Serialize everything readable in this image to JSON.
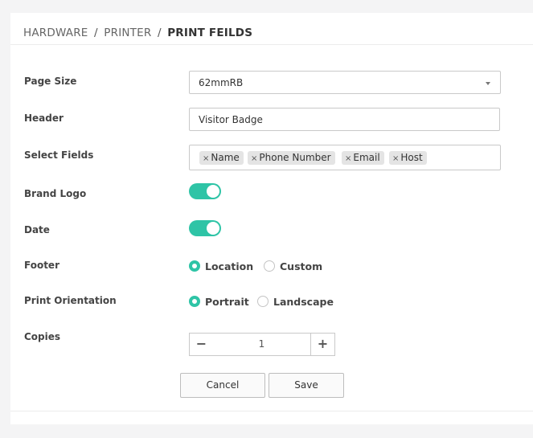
{
  "breadcrumb": {
    "items": [
      "HARDWARE",
      "PRINTER"
    ],
    "separator": "/",
    "current": "PRINT FEILDS"
  },
  "form": {
    "page_size": {
      "label": "Page Size",
      "value": "62mmRB"
    },
    "header": {
      "label": "Header",
      "value": "Visitor Badge"
    },
    "select_fields": {
      "label": "Select Fields",
      "remove_glyph": "×",
      "chips": [
        "Name",
        "Phone Number",
        "Email",
        "Host"
      ]
    },
    "brand_logo": {
      "label": "Brand Logo",
      "enabled": true
    },
    "date": {
      "label": "Date",
      "enabled": true
    },
    "footer": {
      "label": "Footer",
      "options": [
        "Location",
        "Custom"
      ],
      "selected": "Location"
    },
    "print_orientation": {
      "label": "Print Orientation",
      "options": [
        "Portrait",
        "Landscape"
      ],
      "selected": "Portrait"
    },
    "copies": {
      "label": "Copies",
      "value": "1",
      "minus": "−",
      "plus": "+"
    }
  },
  "actions": {
    "cancel_label": "Cancel",
    "save_label": "Save"
  },
  "colors": {
    "accent": "#2ec4a6",
    "border": "#c9c9c9",
    "chip_bg": "#e4e4e4"
  },
  "icons": [
    "chevron-down-icon",
    "remove-icon",
    "minus-icon",
    "plus-icon"
  ]
}
